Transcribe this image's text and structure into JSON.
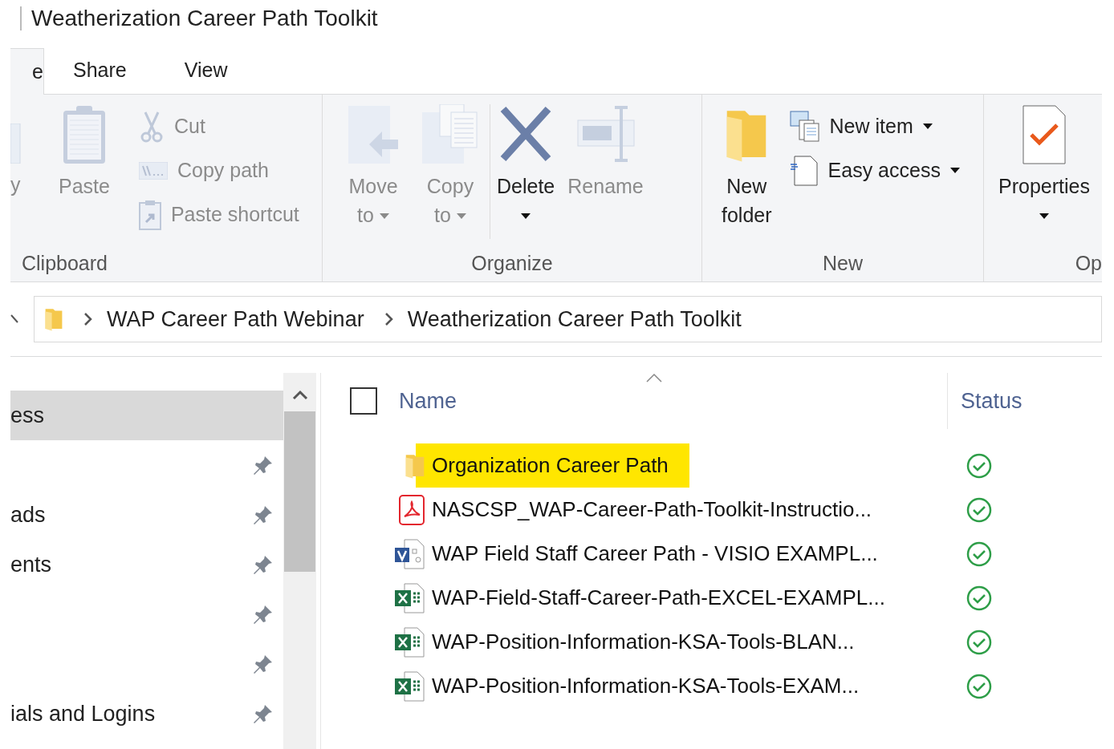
{
  "window": {
    "title": "Weatherization Career Path Toolkit"
  },
  "tabs": [
    {
      "label": "e",
      "selected": true
    },
    {
      "label": "Share",
      "selected": false
    },
    {
      "label": "View",
      "selected": false
    }
  ],
  "ribbon": {
    "groups": [
      {
        "label": "Clipboard",
        "buttons": [
          {
            "label": "y",
            "disabled": true
          },
          {
            "label": "Paste",
            "disabled": true
          },
          {
            "label": "Cut",
            "disabled": true
          },
          {
            "label": "Copy path",
            "disabled": true
          },
          {
            "label": "Paste shortcut",
            "disabled": true
          }
        ]
      },
      {
        "label": "Organize",
        "buttons": [
          {
            "label": "Move to",
            "disabled": true
          },
          {
            "label": "Copy to",
            "disabled": true
          },
          {
            "label": "Delete",
            "disabled": false
          },
          {
            "label": "Rename",
            "disabled": true
          }
        ]
      },
      {
        "label": "New",
        "buttons": [
          {
            "label": "New folder",
            "disabled": false
          },
          {
            "label": "New item",
            "disabled": false
          },
          {
            "label": "Easy access",
            "disabled": false
          }
        ]
      },
      {
        "label": "Op",
        "buttons": [
          {
            "label": "Properties",
            "disabled": false
          }
        ]
      }
    ]
  },
  "address": {
    "breadcrumbs": [
      "WAP Career Path Webinar",
      "Weatherization Career Path Toolkit"
    ]
  },
  "nav": {
    "items": [
      {
        "label": "ess",
        "selected": true,
        "pinned": false
      },
      {
        "selected": false,
        "pinned": true
      },
      {
        "label": "ads",
        "selected": false,
        "pinned": true
      },
      {
        "label": "ents",
        "selected": false,
        "pinned": true
      },
      {
        "selected": false,
        "pinned": true
      },
      {
        "selected": false,
        "pinned": true
      },
      {
        "label": "ials and Logins",
        "selected": false,
        "pinned": true
      }
    ]
  },
  "files": {
    "select_all": {
      "checked": false
    },
    "columns": [
      "Name",
      "Status"
    ],
    "rows": [
      {
        "name": "Organization Career Path",
        "kind": "folder",
        "highlighted": true,
        "synced": true
      },
      {
        "name": "NASCSP_WAP-Career-Path-Toolkit-Instructio...",
        "kind": "pdf",
        "highlighted": false,
        "synced": true
      },
      {
        "name": "WAP Field Staff Career Path - VISIO EXAMPL...",
        "kind": "visio",
        "highlighted": false,
        "synced": true
      },
      {
        "name": "WAP-Field-Staff-Career-Path-EXCEL-EXAMPL...",
        "kind": "excel",
        "highlighted": false,
        "synced": true
      },
      {
        "name": "WAP-Position-Information-KSA-Tools-BLAN...",
        "kind": "excel",
        "highlighted": false,
        "synced": true
      },
      {
        "name": "WAP-Position-Information-KSA-Tools-EXAM...",
        "kind": "excel",
        "highlighted": false,
        "synced": true
      }
    ]
  }
}
